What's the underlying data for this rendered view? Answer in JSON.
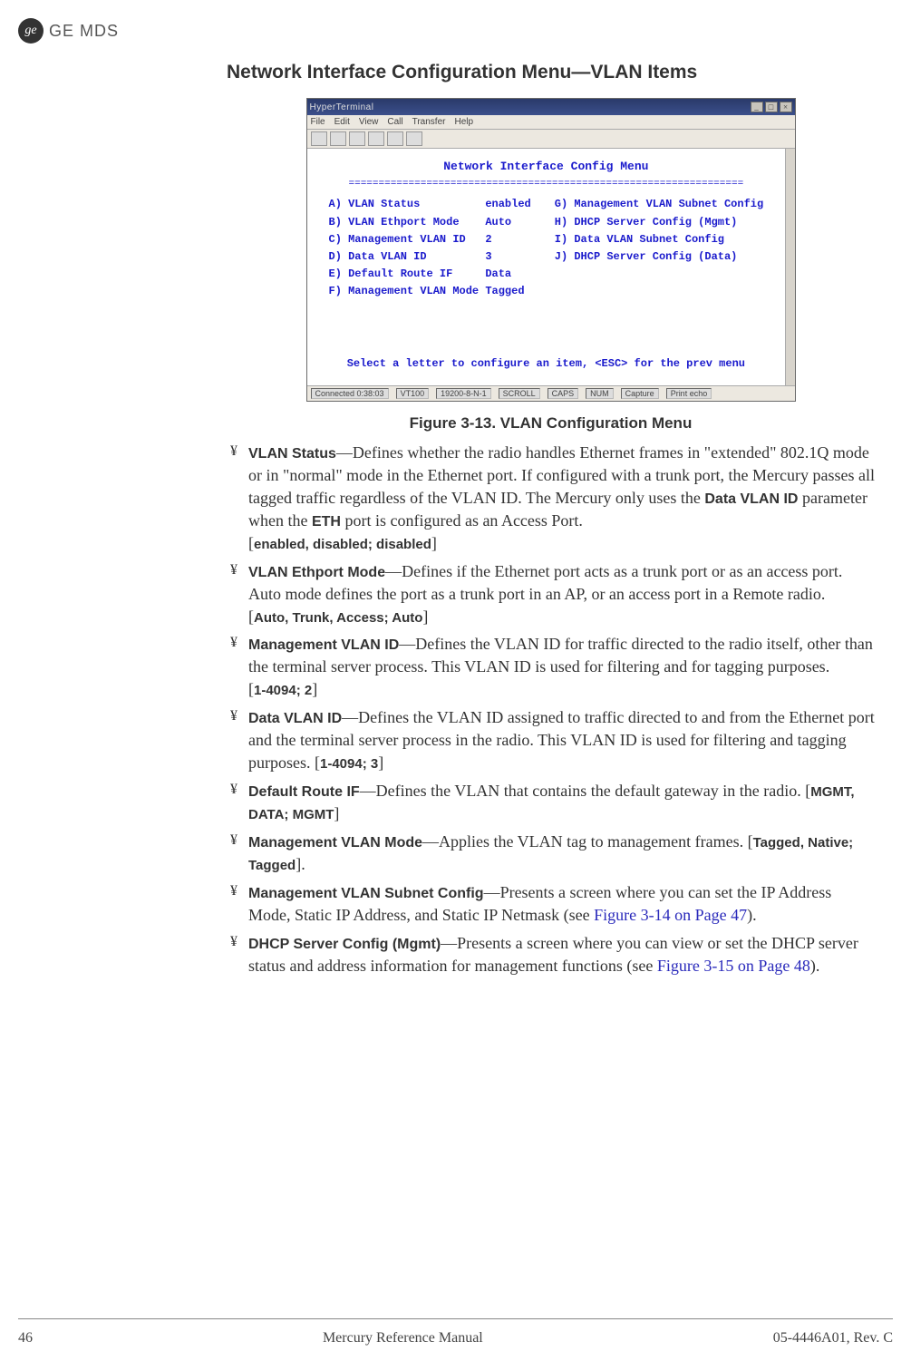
{
  "brand": {
    "logo_text": "ge",
    "name": "GE MDS"
  },
  "section_title": "Network Interface Configuration Menu—VLAN Items",
  "screenshot": {
    "title_bar": "HyperTerminal",
    "menubar": [
      "File",
      "Edit",
      "View",
      "Call",
      "Transfer",
      "Help"
    ],
    "term_title": "Network Interface Config Menu",
    "term_underline": "==================================================================",
    "left_col": "A) VLAN Status          enabled\nB) VLAN Ethport Mode    Auto\nC) Management VLAN ID   2\nD) Data VLAN ID         3\nE) Default Route IF     Data\nF) Management VLAN Mode Tagged",
    "right_col": "G) Management VLAN Subnet Config\nH) DHCP Server Config (Mgmt)\nI) Data VLAN Subnet Config\nJ) DHCP Server Config (Data)",
    "term_footer": "Select a letter to configure an item, <ESC> for the prev menu",
    "status": [
      "Connected 0:38:03",
      "VT100",
      "19200-8-N-1",
      "SCROLL",
      "CAPS",
      "NUM",
      "Capture",
      "Print echo"
    ]
  },
  "caption": "Figure 3-13. VLAN Configuration Menu",
  "items": [
    {
      "label": "VLAN Status",
      "desc1": "—Defines whether the radio handles Ethernet frames in \"extended\" 802.1Q mode or in \"normal\" mode in the Ethernet port. If configured with a trunk port, the Mercury passes all tagged traffic regardless of the VLAN ID. The Mercury only uses the ",
      "inline": "Data VLAN ID",
      "desc2": " parameter when the ",
      "inline2": "ETH",
      "desc3": " port is configured as an Access Port.",
      "opts": "enabled, disabled; disabled"
    },
    {
      "label": "VLAN Ethport Mode",
      "desc": "—Defines if the Ethernet port acts as a trunk port or as an access port. Auto mode defines the port as a trunk port in an AP, or an access port in a Remote radio.",
      "opts": "Auto, Trunk, Access; Auto"
    },
    {
      "label": "Management VLAN ID",
      "desc": "—Defines the VLAN ID for traffic directed to the radio itself, other than the terminal server process. This VLAN ID is used for filtering and for tagging purposes.",
      "opts": "1-4094; 2"
    },
    {
      "label": "Data VLAN ID",
      "desc": "—Defines the VLAN ID assigned to traffic directed to and from the Ethernet port and the terminal server process in the radio. This VLAN ID is used for filtering and tagging purposes. ",
      "opts": "1-4094; 3",
      "inline_opts": true
    },
    {
      "label": "Default Route IF",
      "desc": "—Defines the VLAN that contains the default gateway in the radio. ",
      "opts": "MGMT, DATA; MGMT",
      "inline_opts": true
    },
    {
      "label": "Management VLAN Mode",
      "desc": "—Applies the VLAN tag to management frames. ",
      "opts": "Tagged, Native; Tagged",
      "inline_opts": true,
      "trail": "."
    },
    {
      "label": "Management VLAN Subnet Config",
      "desc": "—Presents a screen where you can set the IP Address Mode, Static IP Address, and Static IP Netmask (see ",
      "xref": "Figure 3-14 on Page 47",
      "desc2": ")."
    },
    {
      "label": "DHCP Server Config (Mgmt)",
      "desc": "—Presents a screen where you can view or set the DHCP server status and address information for management functions (see ",
      "xref": "Figure 3-15 on Page 48",
      "desc2": ")."
    }
  ],
  "footer": {
    "page": "46",
    "center": "Mercury Reference Manual",
    "right": "05-4446A01, Rev. C"
  }
}
